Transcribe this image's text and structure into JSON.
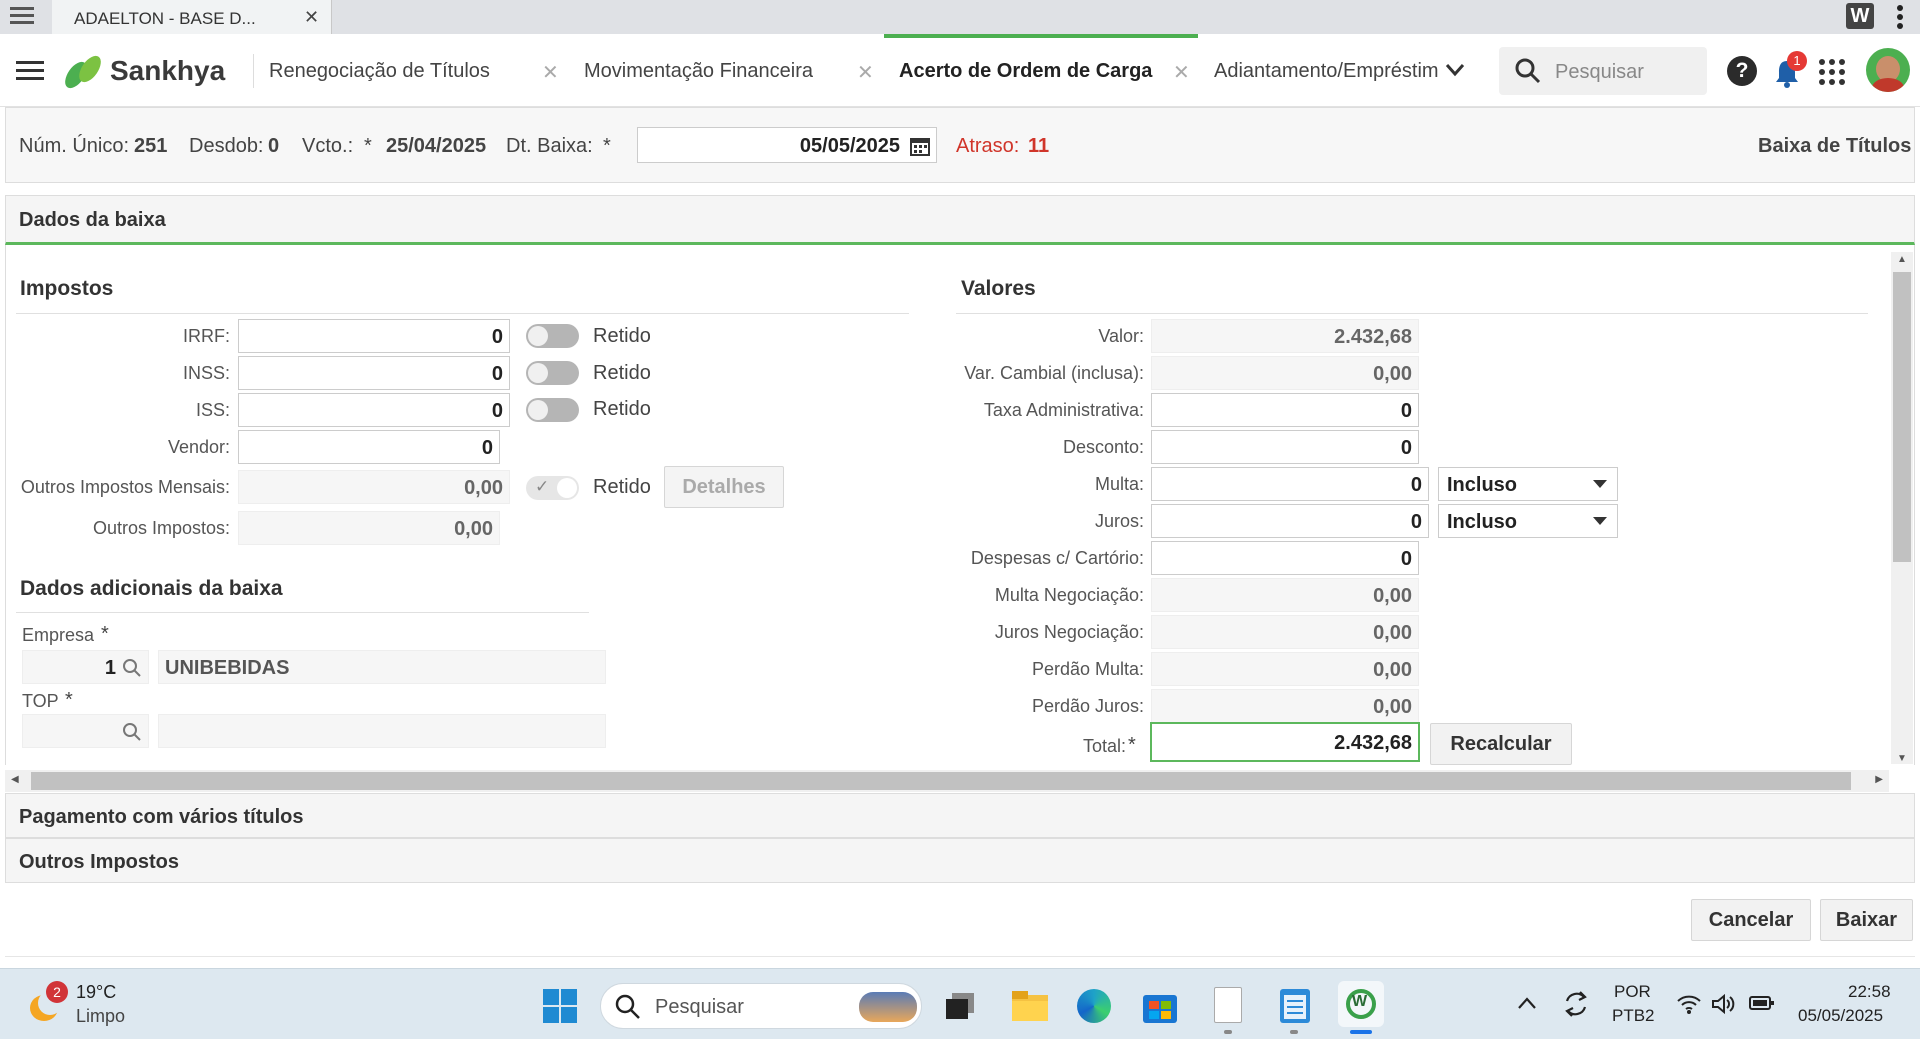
{
  "browser": {
    "tab_title": "ADAELTON - BASE D..."
  },
  "app": {
    "brand": "Sankhya",
    "tabs": [
      {
        "label": "Renegociação de Títulos"
      },
      {
        "label": "Movimentação Financeira"
      },
      {
        "label": "Acerto de Ordem de Carga"
      },
      {
        "label": "Adiantamento/Empréstim"
      }
    ],
    "search_placeholder": "Pesquisar",
    "notification_count": "1"
  },
  "info": {
    "num_unico_label": "Núm. Único:",
    "num_unico_value": "251",
    "desdob_label": "Desdob:",
    "desdob_value": "0",
    "vcto_label": "Vcto.:",
    "vcto_value": "25/04/2025",
    "dt_baixa_label": "Dt. Baixa:",
    "dt_baixa_value": "05/05/2025",
    "atraso_label": "Atraso:",
    "atraso_value": "11",
    "page_title": "Baixa de Títulos"
  },
  "panel": {
    "title": "Dados da baixa",
    "impostos": {
      "title": "Impostos",
      "rows": [
        {
          "label": "IRRF:",
          "value": "0",
          "toggle_label": "Retido"
        },
        {
          "label": "INSS:",
          "value": "0",
          "toggle_label": "Retido"
        },
        {
          "label": "ISS:",
          "value": "0",
          "toggle_label": "Retido"
        },
        {
          "label": "Vendor:",
          "value": "0"
        },
        {
          "label": "Outros Impostos Mensais:",
          "value": "0,00",
          "toggle_label": "Retido",
          "button": "Detalhes"
        },
        {
          "label": "Outros Impostos:",
          "value": "0,00"
        }
      ]
    },
    "adicionais": {
      "title": "Dados adicionais da baixa",
      "empresa_label": "Empresa",
      "empresa_code": "1",
      "empresa_name": "UNIBEBIDAS",
      "top_label": "TOP",
      "top_code": "",
      "top_name": ""
    },
    "valores": {
      "title": "Valores",
      "rows": [
        {
          "label": "Valor:",
          "value": "2.432,68"
        },
        {
          "label": "Var. Cambial (inclusa):",
          "value": "0,00"
        },
        {
          "label": "Taxa Administrativa:",
          "value": "0"
        },
        {
          "label": "Desconto:",
          "value": "0"
        },
        {
          "label": "Multa:",
          "value": "0",
          "select": "Incluso"
        },
        {
          "label": "Juros:",
          "value": "0",
          "select": "Incluso"
        },
        {
          "label": "Despesas c/ Cartório:",
          "value": "0"
        },
        {
          "label": "Multa Negociação:",
          "value": "0,00"
        },
        {
          "label": "Juros Negociação:",
          "value": "0,00"
        },
        {
          "label": "Perdão Multa:",
          "value": "0,00"
        },
        {
          "label": "Perdão Juros:",
          "value": "0,00"
        },
        {
          "label": "Total:",
          "value": "2.432,68"
        }
      ],
      "recalcular": "Recalcular"
    }
  },
  "collapsed": {
    "pagamento": "Pagamento com vários títulos",
    "outros": "Outros Impostos"
  },
  "footer": {
    "cancel": "Cancelar",
    "baixar": "Baixar"
  },
  "taskbar": {
    "weather_badge": "2",
    "temperature": "19°C",
    "weather": "Limpo",
    "search_placeholder": "Pesquisar",
    "lang1": "POR",
    "lang2": "PTB2",
    "time": "22:58",
    "date": "05/05/2025"
  },
  "colors": {
    "accent_green": "#4caf50",
    "required_red": "#d0352a"
  }
}
